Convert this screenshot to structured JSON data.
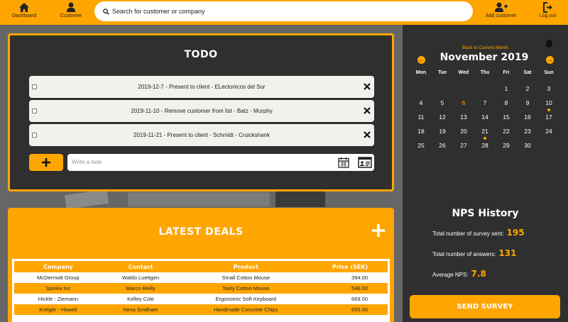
{
  "nav": {
    "dashboard": "Dashboard",
    "customer": "Customer",
    "add_customer": "Add customer",
    "logout": "Log out",
    "search_placeholder": "Search for customer or company"
  },
  "todo": {
    "title": "TODO",
    "tasks": [
      "2019-12-7 - Present to client - ELectonicos del Sur",
      "2019-11-10 - Remove customer from list - Batz - Murphy",
      "2019-11-21 - Present to client - Schmidt - Cruickshank"
    ],
    "input_placeholder": "Write a task"
  },
  "deals": {
    "title": "LATEST DEALS",
    "headers": [
      "Company",
      "Contact",
      "Product",
      "Price (SEK)"
    ],
    "rows": [
      [
        "McDermott Group",
        "Waldo Luettgen",
        "Small Cotton Mouse",
        "394.00"
      ],
      [
        "Spinka Inc",
        "Marco Reilly",
        "Tasty Cotton Mouse",
        "546.00"
      ],
      [
        "Hickle - Ziemann",
        "Kelley Cole",
        "Ergonomic Soft Keyboard",
        "669.00"
      ],
      [
        "Kreiger - Howell",
        "Neva Smitham",
        "Handmade Concrete Chips",
        "655.00"
      ]
    ]
  },
  "calendar": {
    "back_label": "Back to Current Month",
    "month_label": "November 2019",
    "weekdays": [
      "Mon",
      "Tue",
      "Wed",
      "Thu",
      "Fri",
      "Sat",
      "Sun"
    ],
    "weeks": [
      [
        "",
        "",
        "",
        "",
        "1",
        "2",
        "3"
      ],
      [
        "4",
        "5",
        "6",
        "7",
        "8",
        "9",
        "10"
      ],
      [
        "11",
        "12",
        "13",
        "14",
        "15",
        "16",
        "17"
      ],
      [
        "18",
        "19",
        "20",
        "21",
        "22",
        "23",
        "24"
      ],
      [
        "25",
        "26",
        "27",
        "28",
        "29",
        "30",
        ""
      ]
    ],
    "today": "6",
    "event_days": [
      "10",
      "21"
    ]
  },
  "nps": {
    "title": "NPS History",
    "sent_label": "Total number of survey sent:",
    "sent_value": "195",
    "answers_label": "Total number of answers:",
    "answers_value": "131",
    "average_label": "Average NPS:",
    "average_value": "7.8",
    "send_button": "SEND SURVEY"
  },
  "colors": {
    "accent": "#ffa500",
    "panel": "#2f2f2f"
  }
}
